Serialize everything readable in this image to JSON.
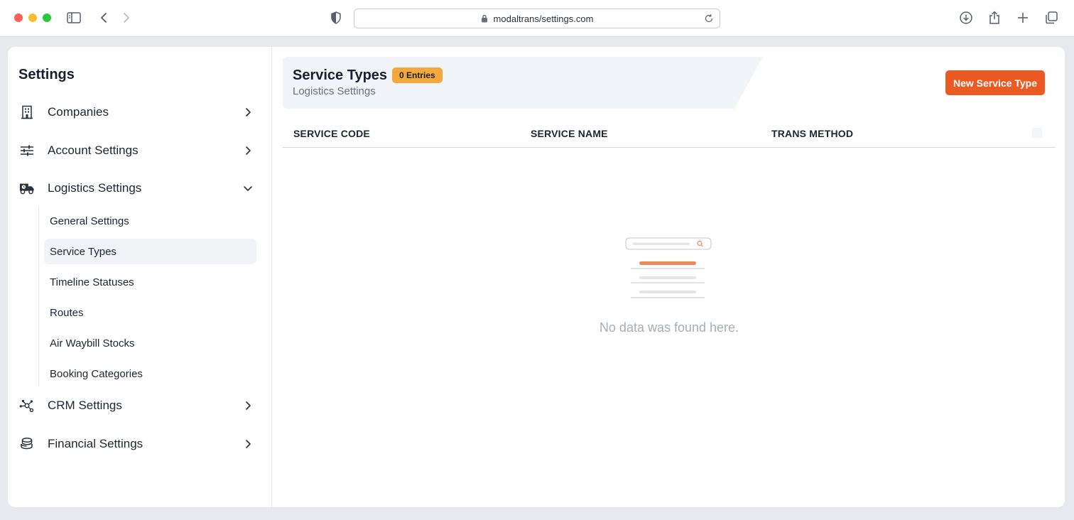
{
  "browser": {
    "url": "modaltrans/settings.com"
  },
  "sidebar": {
    "title": "Settings",
    "items": [
      {
        "label": "Companies",
        "icon": "building-icon",
        "state": "collapsed"
      },
      {
        "label": "Account Settings",
        "icon": "sliders-icon",
        "state": "collapsed"
      },
      {
        "label": "Logistics Settings",
        "icon": "truck-icon",
        "state": "expanded"
      },
      {
        "label": "CRM Settings",
        "icon": "network-icon",
        "state": "collapsed"
      },
      {
        "label": "Financial Settings",
        "icon": "coins-icon",
        "state": "collapsed"
      }
    ],
    "logistics_subitems": [
      {
        "label": "General Settings",
        "active": false
      },
      {
        "label": "Service Types",
        "active": true
      },
      {
        "label": "Timeline Statuses",
        "active": false
      },
      {
        "label": "Routes",
        "active": false
      },
      {
        "label": "Air Waybill Stocks",
        "active": false
      },
      {
        "label": "Booking Categories",
        "active": false
      }
    ]
  },
  "main": {
    "title": "Service Types",
    "badge": "0 Entries",
    "subtitle": "Logistics Settings",
    "new_button_label": "New Service Type",
    "columns": [
      "SERVICE CODE",
      "SERVICE NAME",
      "TRANS METHOD"
    ],
    "empty_message": "No data was found here."
  },
  "colors": {
    "accent": "#ec5a24",
    "badge": "#f4a93c",
    "header_bg": "#f1f4f8",
    "active_item_bg": "#f1f3f7"
  }
}
